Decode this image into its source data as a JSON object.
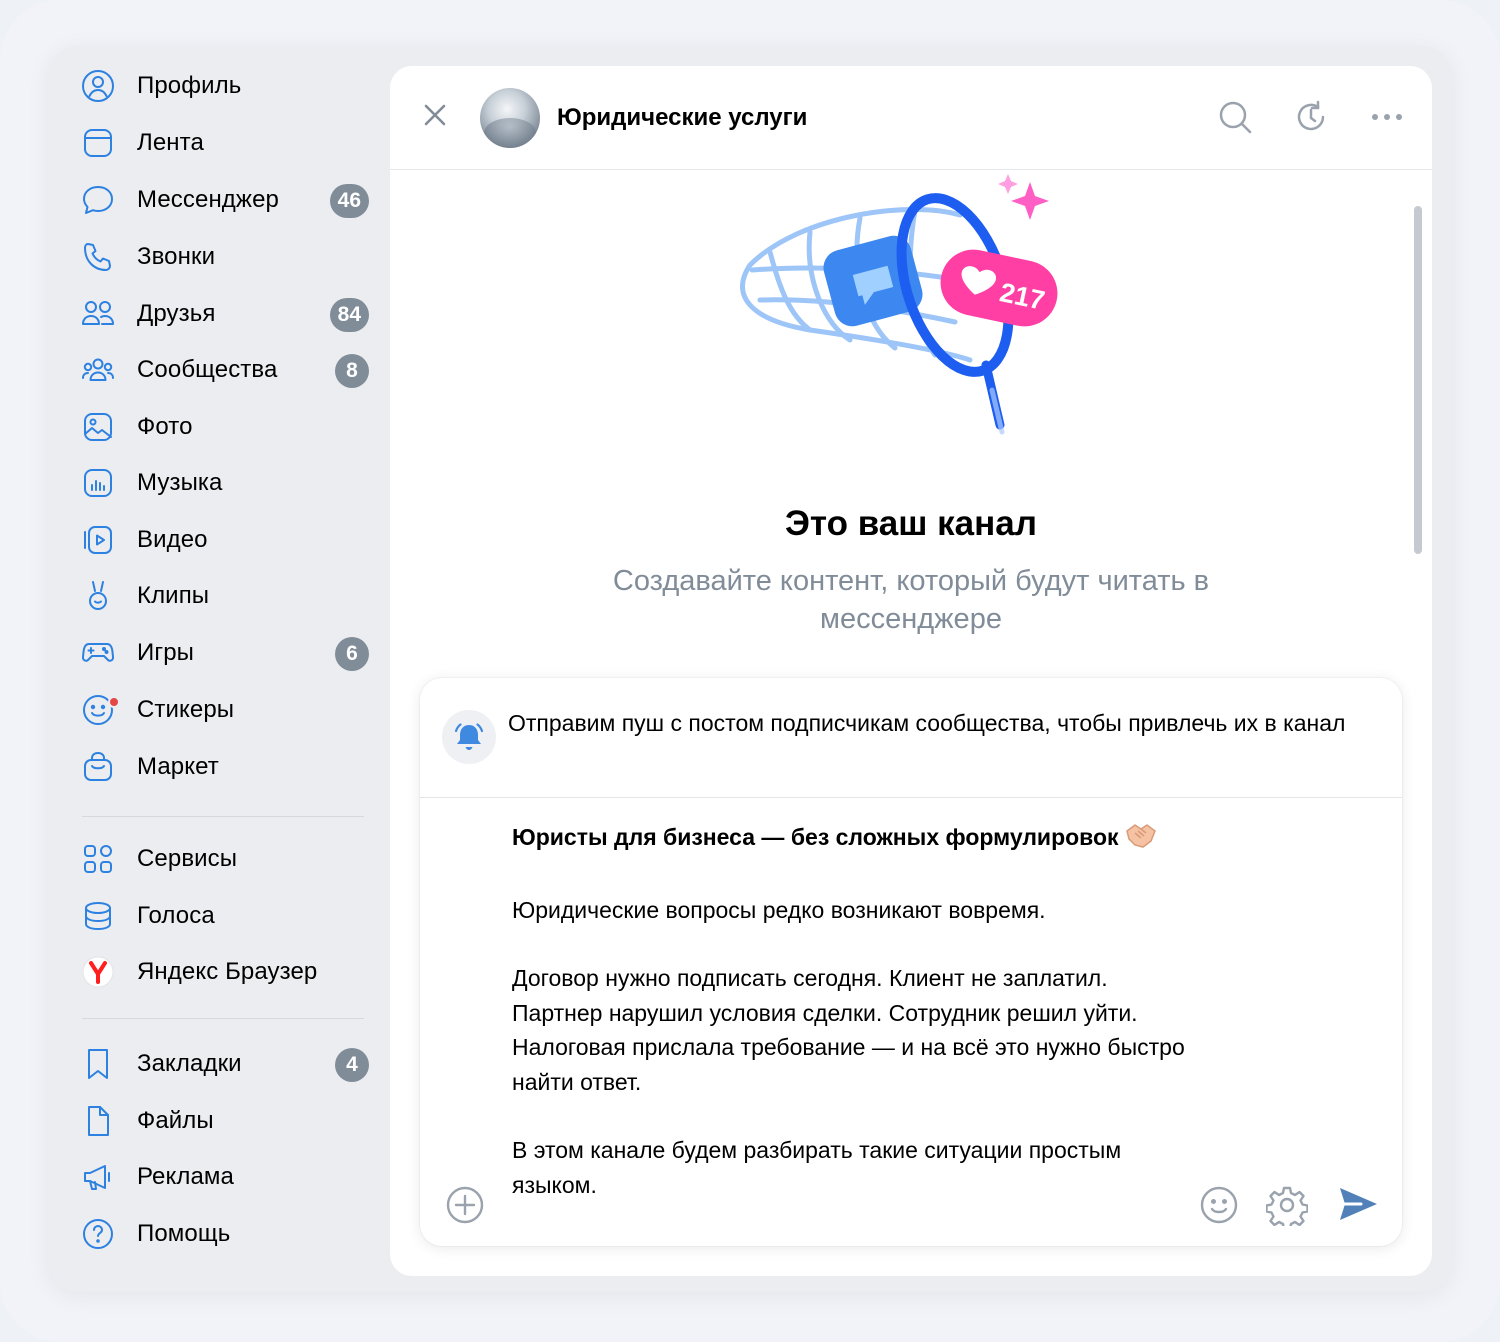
{
  "sidebar": {
    "items": [
      {
        "label": "Профиль",
        "icon": "profile-icon"
      },
      {
        "label": "Лента",
        "icon": "feed-icon"
      },
      {
        "label": "Мессенджер",
        "icon": "messenger-icon",
        "badge": "46"
      },
      {
        "label": "Звонки",
        "icon": "phone-icon"
      },
      {
        "label": "Друзья",
        "icon": "friends-icon",
        "badge": "84"
      },
      {
        "label": "Сообщества",
        "icon": "communities-icon",
        "badge": "8"
      },
      {
        "label": "Фото",
        "icon": "photo-icon"
      },
      {
        "label": "Музыка",
        "icon": "music-icon"
      },
      {
        "label": "Видео",
        "icon": "video-icon"
      },
      {
        "label": "Клипы",
        "icon": "clips-icon"
      },
      {
        "label": "Игры",
        "icon": "gamepad-icon",
        "badge": "6"
      },
      {
        "label": "Стикеры",
        "icon": "sticker-icon"
      },
      {
        "label": "Маркет",
        "icon": "market-icon"
      },
      {
        "label": "Сервисы",
        "icon": "services-icon"
      },
      {
        "label": "Голоса",
        "icon": "votes-icon"
      },
      {
        "label": "Яндекс Браузер",
        "icon": "yandex-browser-icon"
      },
      {
        "label": "Закладки",
        "icon": "bookmark-icon",
        "badge": "4"
      },
      {
        "label": "Файлы",
        "icon": "file-icon"
      },
      {
        "label": "Реклама",
        "icon": "megaphone-icon"
      },
      {
        "label": "Помощь",
        "icon": "help-icon"
      }
    ]
  },
  "chat": {
    "title": "Юридические услуги",
    "hero_badge": "217",
    "hero_title": "Это ваш канал",
    "hero_subtitle": "Создавайте контент, который будут читать в мессенджере"
  },
  "composer": {
    "push_text": "Отправим пуш с постом подписчикам сообщества, чтобы привлечь их в канал",
    "post_title": "Юристы для бизнеса — без сложных формулировок",
    "post_p1": "Юридические вопросы редко возникают вовремя.",
    "post_p2": "Договор нужно подписать сегодня. Клиент не заплатил. Партнер нарушил условия сделки. Сотрудник решил уйти. Налоговая прислала требование — и на всё это нужно быстро найти ответ.",
    "post_p3": "В этом канале будем разбирать такие ситуации простым языком."
  },
  "colors": {
    "accent": "#2d81e0",
    "badge": "#818c99",
    "icon_gray": "#99a2ad",
    "send": "#5181b8",
    "pink": "#ff3fa4"
  }
}
